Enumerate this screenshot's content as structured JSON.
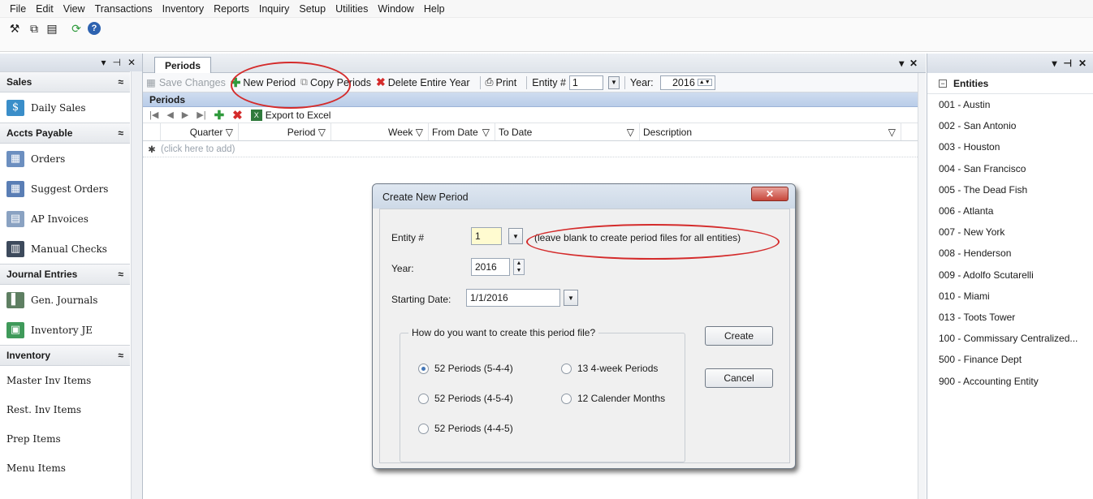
{
  "menubar": [
    "File",
    "Edit",
    "View",
    "Transactions",
    "Inventory",
    "Reports",
    "Inquiry",
    "Setup",
    "Utilities",
    "Window",
    "Help"
  ],
  "left_panel": {
    "groups": [
      {
        "title": "Sales",
        "items": [
          {
            "label": "Daily Sales",
            "icon": "daily-sales-icon"
          }
        ]
      },
      {
        "title": "Accts Payable",
        "items": [
          {
            "label": "Orders",
            "icon": "orders-icon"
          },
          {
            "label": "Suggest Orders",
            "icon": "suggest-orders-icon"
          },
          {
            "label": "AP Invoices",
            "icon": "ap-invoices-icon"
          },
          {
            "label": "Manual Checks",
            "icon": "manual-checks-icon"
          }
        ]
      },
      {
        "title": "Journal Entries",
        "items": [
          {
            "label": "Gen. Journals",
            "icon": "gen-journals-icon"
          },
          {
            "label": "Inventory JE",
            "icon": "inventory-je-icon"
          }
        ]
      },
      {
        "title": "Inventory",
        "items": [
          {
            "label": "Master Inv Items"
          },
          {
            "label": "Rest. Inv Items"
          },
          {
            "label": "Prep Items"
          },
          {
            "label": "Menu Items"
          }
        ]
      }
    ]
  },
  "doc_tab": "Periods",
  "toolbar": {
    "save": "Save Changes",
    "new_period": "New Period",
    "copy_periods": "Copy Periods",
    "delete_year": "Delete Entire Year",
    "print": "Print",
    "entity_label": "Entity #",
    "entity_value": "1",
    "year_label": "Year:",
    "year_value": "2016"
  },
  "grid": {
    "title": "Periods",
    "export": "Export to Excel",
    "columns": [
      "Quarter",
      "Period",
      "Week",
      "From Date",
      "To Date",
      "Description"
    ],
    "add_row": "(click here to add)"
  },
  "entities": {
    "header": "Entities",
    "items": [
      "001 - Austin",
      "002 - San Antonio",
      "003 - Houston",
      "004 - San Francisco",
      "005 - The Dead Fish",
      "006 - Atlanta",
      "007 - New York",
      "008 - Henderson",
      "009 - Adolfo Scutarelli",
      "010 - Miami",
      "013 - Toots Tower",
      "100 - Commissary Centralized...",
      "500 - Finance Dept",
      "900 - Accounting Entity"
    ]
  },
  "dialog": {
    "title": "Create New Period",
    "entity_label": "Entity #",
    "entity_value": "1",
    "entity_hint": "(leave blank to create period files for all entities)",
    "year_label": "Year:",
    "year_value": "2016",
    "start_label": "Starting Date:",
    "start_value": "1/1/2016",
    "group_title": "How do you want to create this period file?",
    "options": {
      "p544": "52 Periods (5-4-4)",
      "p454": "52 Periods (4-5-4)",
      "p445": "52 Periods (4-4-5)",
      "p13": "13 4-week Periods",
      "p12": "12 Calender Months"
    },
    "selected_option": "52 Periods (5-4-4)",
    "create": "Create",
    "cancel": "Cancel"
  },
  "colors": {
    "annotation": "#d42b2b",
    "grid_header": "#b9cde9",
    "accent": "#4477b7"
  }
}
